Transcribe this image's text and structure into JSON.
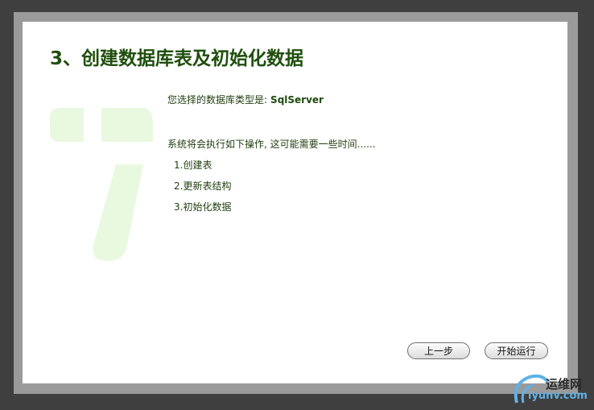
{
  "page": {
    "title": "3、创建数据库表及初始化数据"
  },
  "info": {
    "db_prefix": "您选择的数据库类型是:",
    "db_type": "SqlServer",
    "description": "系统将会执行如下操作, 这可能需要一些时间......"
  },
  "steps": [
    "1.创建表",
    "2.更新表结构",
    "3.初始化数据"
  ],
  "buttons": {
    "prev_label": "上一步",
    "start_label": "开始运行"
  },
  "watermark": {
    "line1": "运维网",
    "line2": "iyunv.com"
  },
  "colors": {
    "title": "#1f4f0d",
    "logo_fill": "#e9f9df",
    "frame": "#9a9a9a",
    "background": "#3f3f3f"
  }
}
